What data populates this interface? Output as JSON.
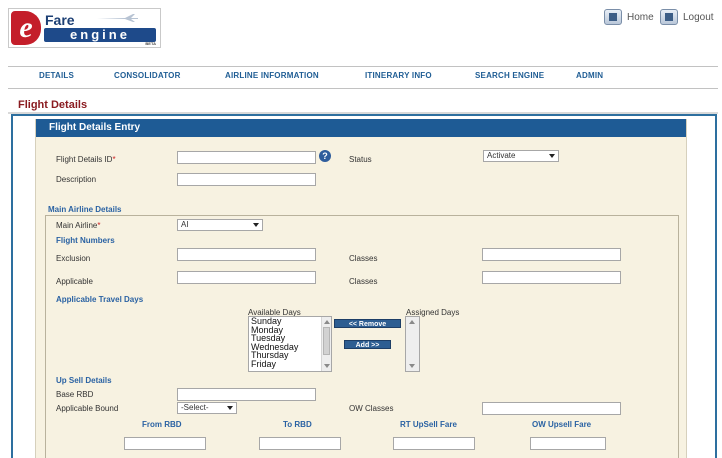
{
  "logo": {
    "fare": "Fare",
    "engine": "engine",
    "beta": "BETA"
  },
  "top_links": {
    "home": "Home",
    "logout": "Logout"
  },
  "nav": [
    "DETAILS",
    "CONSOLIDATOR",
    "AIRLINE INFORMATION",
    "ITINERARY INFO",
    "SEARCH ENGINE",
    "ADMIN"
  ],
  "page_title": "Flight Details",
  "panel_title": "Flight Details Entry",
  "form": {
    "flight_details_id_label": "Flight Details ID",
    "required_mark": "*",
    "help_icon": "?",
    "status_label": "Status",
    "status_value": "Activate",
    "description_label": "Description",
    "main_airline_section": "Main Airline Details",
    "main_airline_label": "Main Airline",
    "main_airline_value": "AI",
    "flight_numbers_section": "Flight Numbers",
    "exclusion_label": "Exclusion",
    "classes_label_1": "Classes",
    "applicable_label": "Applicable",
    "classes_label_2": "Classes",
    "travel_days_section": "Applicable Travel Days",
    "available_days_label": "Available Days",
    "assigned_days_label": "Assigned Days",
    "available_days": [
      "Sunday",
      "Monday",
      "Tuesday",
      "Wednesday",
      "Thursday",
      "Friday"
    ],
    "remove_button": "<< Remove",
    "add_button": "Add >>",
    "upsell_section": "Up Sell Details",
    "base_rbd_label": "Base RBD",
    "applicable_bound_label": "Applicable Bound",
    "applicable_bound_value": "-Select-",
    "ow_classes_label": "OW Classes",
    "from_rbd_label": "From RBD",
    "to_rbd_label": "To RBD",
    "rt_upsell_label": "RT UpSell Fare",
    "ow_upsell_label": "OW Upsell Fare"
  }
}
